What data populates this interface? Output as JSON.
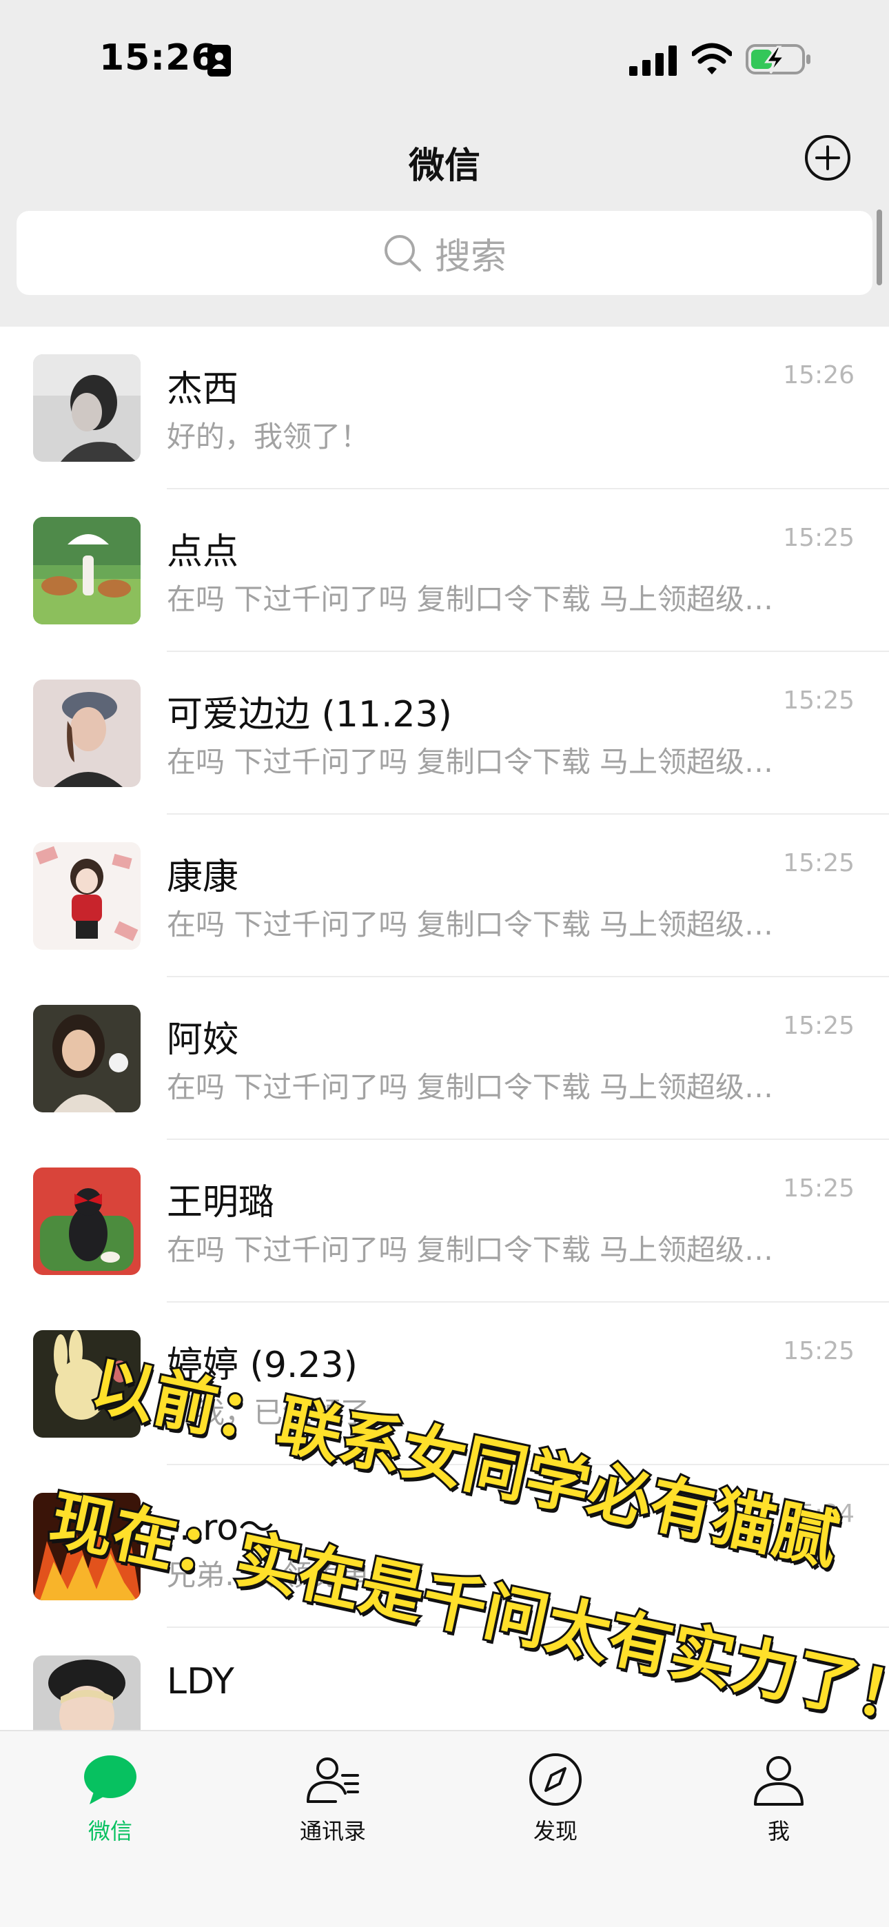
{
  "status_bar": {
    "time": "15:26",
    "icons": [
      "id-card-icon",
      "cellular-signal-icon",
      "wifi-icon",
      "battery-charging-icon"
    ]
  },
  "nav": {
    "title": "微信",
    "add_icon": "plus-circle-icon"
  },
  "search": {
    "placeholder": "搜索",
    "icon": "search-icon"
  },
  "chats": [
    {
      "name": "杰西",
      "time": "15:26",
      "preview": "好的，我领了！"
    },
    {
      "name": "点点",
      "time": "15:25",
      "preview": "在吗 下过千问了吗 复制口令下载 马上领超级…"
    },
    {
      "name": "可爱边边 (11.23)",
      "time": "15:25",
      "preview": "在吗 下过千问了吗 复制口令下载 马上领超级…"
    },
    {
      "name": "康康",
      "time": "15:25",
      "preview": "在吗 下过千问了吗 复制口令下载 马上领超级…"
    },
    {
      "name": "阿姣",
      "time": "15:25",
      "preview": "在吗 下过千问了吗 复制口令下载 马上领超级…"
    },
    {
      "name": "王明璐",
      "time": "15:25",
      "preview": "在吗 下过千问了吗 复制口令下载 马上领超级…"
    },
    {
      "name": "婷婷 (9.23)",
      "time": "15:25",
      "preview": "…我，已经领了"
    },
    {
      "name": "…ro～",
      "time": "15:24",
      "preview": "兄弟…令领免单卡了"
    },
    {
      "name": "LDY",
      "time": "",
      "preview": ""
    }
  ],
  "tabs": [
    {
      "label": "微信",
      "icon": "chat-bubble-icon",
      "active": true
    },
    {
      "label": "通讯录",
      "icon": "contacts-icon",
      "active": false
    },
    {
      "label": "发现",
      "icon": "compass-icon",
      "active": false
    },
    {
      "label": "我",
      "icon": "person-icon",
      "active": false
    }
  ],
  "overlay": {
    "line1": "以前：联系女同学必有猫腻",
    "line2": "现在：实在是千问太有实力了！"
  },
  "colors": {
    "accent": "#07c160",
    "header_bg": "#ededed",
    "caption_fill": "#ffe02a",
    "caption_stroke": "#111111"
  }
}
